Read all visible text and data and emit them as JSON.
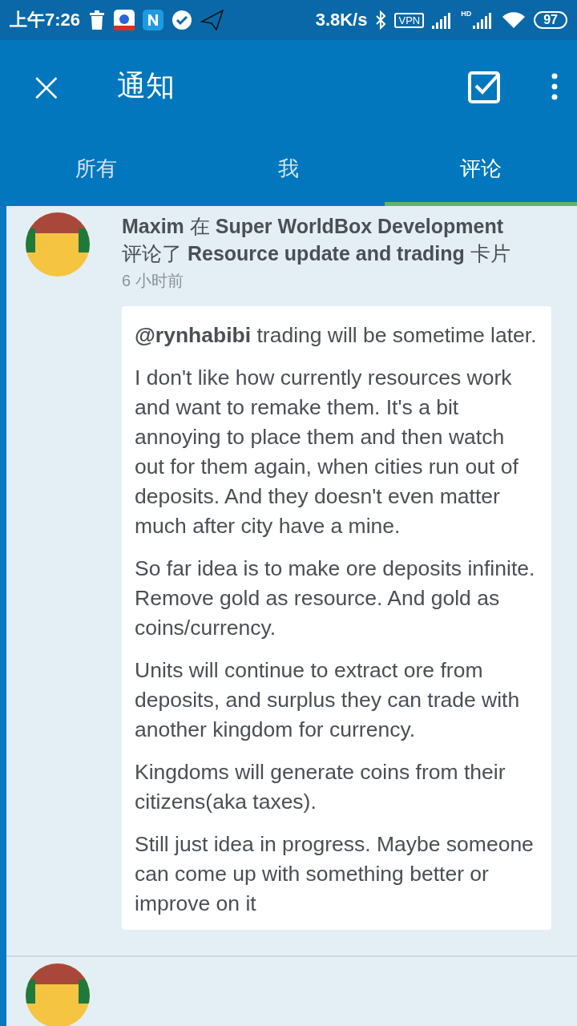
{
  "status_bar": {
    "time": "上午7:26",
    "speed": "3.8K/s",
    "vpn": "VPN",
    "hd": "HD",
    "battery": "97"
  },
  "toolbar": {
    "close": "×",
    "title": "通知"
  },
  "tabs": [
    {
      "label": "所有",
      "selected": false
    },
    {
      "label": "我",
      "selected": false
    },
    {
      "label": "评论",
      "selected": true
    }
  ],
  "notifications": [
    {
      "unread": true,
      "headline": [
        "**Maxim** 在 **Super WorldBox Development**",
        "评论了 **Resource update and trading** 卡片"
      ],
      "time": "6 小时前",
      "comment": [
        "**@rynhabibi** trading will be sometime later.",
        "I don't like how currently resources work and want to remake them. It's a bit annoying to place them and then watch out for them again, when cities run out of deposits. And they doesn't even matter much after city have a mine.",
        "So far idea is to make ore deposits infinite. Remove gold as resource. And gold as coins/currency.",
        "Units will continue to extract ore from deposits, and surplus they can trade with another kingdom for currency.",
        "Kingdoms will generate coins from their citizens(aka taxes).",
        "Still just idea in progress. Maybe someone can come up with something better or improve on it"
      ]
    },
    {
      "unread": true
    }
  ]
}
